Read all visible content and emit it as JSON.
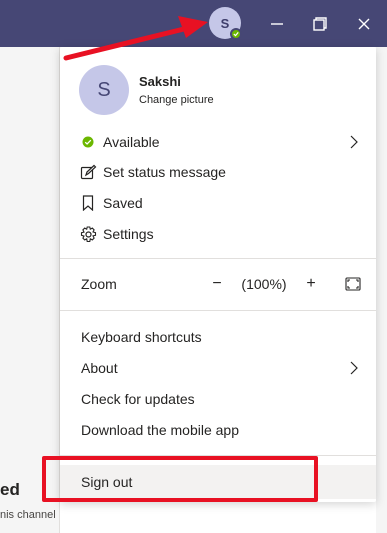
{
  "titlebar": {
    "avatar_initial": "S",
    "colors": {
      "titlebar": "#464775",
      "presence": "#6bb700",
      "annotation": "#e81123"
    }
  },
  "profile": {
    "initial": "S",
    "name": "Sakshi",
    "change_picture": "Change picture"
  },
  "status": {
    "available": "Available",
    "set_status": "Set status message",
    "saved": "Saved",
    "settings": "Settings"
  },
  "zoom": {
    "label": "Zoom",
    "minus": "−",
    "value": "(100%)",
    "plus": "+"
  },
  "help": {
    "keyboard_shortcuts": "Keyboard shortcuts",
    "about": "About",
    "check_updates": "Check for updates",
    "download_mobile": "Download the mobile app"
  },
  "sign_out": "Sign out",
  "background": {
    "heading_fragment": "ed",
    "subtext_fragment": "nis channel"
  }
}
